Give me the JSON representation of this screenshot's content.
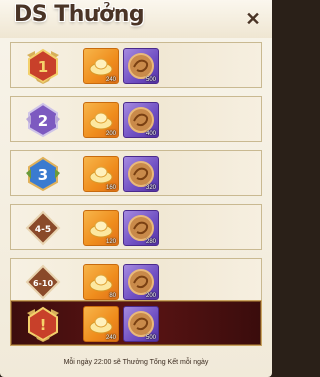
{
  "window": {
    "title": "DS Thưởng",
    "close_symbol": "✕"
  },
  "rows": [
    {
      "rank": "1",
      "badge_color": "#c8402a",
      "rewards": [
        {
          "type": "gold",
          "qty": "240"
        },
        {
          "type": "purple",
          "qty": "500"
        }
      ]
    },
    {
      "rank": "2",
      "badge_color": "#7d5ac0",
      "rewards": [
        {
          "type": "gold",
          "qty": "200"
        },
        {
          "type": "purple",
          "qty": "400"
        }
      ]
    },
    {
      "rank": "3",
      "badge_color": "#3a7bd0",
      "rewards": [
        {
          "type": "gold",
          "qty": "160"
        },
        {
          "type": "purple",
          "qty": "320"
        }
      ]
    },
    {
      "rank": "4-5",
      "badge_color": "#8a4a2a",
      "rewards": [
        {
          "type": "gold",
          "qty": "120"
        },
        {
          "type": "purple",
          "qty": "280"
        }
      ]
    },
    {
      "rank": "6-10",
      "badge_color": "#8a4a2a",
      "rewards": [
        {
          "type": "gold",
          "qty": "80"
        },
        {
          "type": "purple",
          "qty": "200"
        }
      ]
    },
    {
      "rank": "!",
      "badge_color": "#c8402a",
      "mine": true,
      "rewards": [
        {
          "type": "gold",
          "qty": "240"
        },
        {
          "type": "purple",
          "qty": "500"
        }
      ]
    }
  ],
  "footer": {
    "note": "Mỗi ngày 22:00 sẽ Thưởng Tổng Kết mỗi ngày"
  }
}
